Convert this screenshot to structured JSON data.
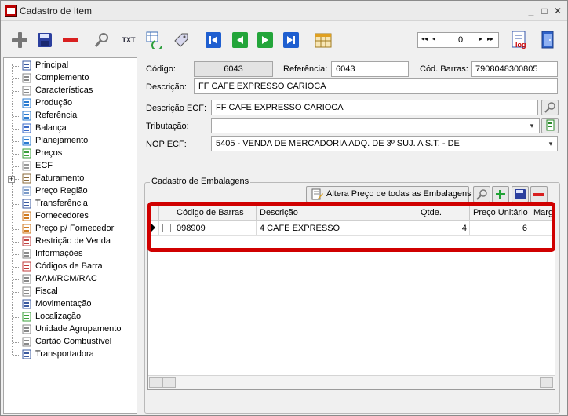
{
  "window": {
    "title": "Cadastro de Item"
  },
  "titlebar_buttons": [
    "_",
    "□",
    "✕"
  ],
  "toolbar": {
    "txt_label": "TXT",
    "counter": {
      "value": "0",
      "first": "◂◂",
      "prev": "◂",
      "next": "▸",
      "last": "▸▸"
    },
    "log_label": "log"
  },
  "sidebar": {
    "items": [
      {
        "label": "Principal"
      },
      {
        "label": "Complemento"
      },
      {
        "label": "Características"
      },
      {
        "label": "Produção"
      },
      {
        "label": "Referência"
      },
      {
        "label": "Balança"
      },
      {
        "label": "Planejamento"
      },
      {
        "label": "Preços"
      },
      {
        "label": "ECF"
      },
      {
        "label": "Faturamento"
      },
      {
        "label": "Preço Região"
      },
      {
        "label": "Transferência"
      },
      {
        "label": "Fornecedores"
      },
      {
        "label": "Preço p/ Fornecedor"
      },
      {
        "label": "Restrição de Venda"
      },
      {
        "label": "Informações"
      },
      {
        "label": "Códigos de Barra"
      },
      {
        "label": "RAM/RCM/RAC"
      },
      {
        "label": "Fiscal"
      },
      {
        "label": "Movimentação"
      },
      {
        "label": "Localização"
      },
      {
        "label": "Unidade Agrupamento"
      },
      {
        "label": "Cartão Combustível"
      },
      {
        "label": "Transportadora"
      }
    ]
  },
  "form": {
    "codigo_label": "Código:",
    "codigo_value": "6043",
    "referencia_label": "Referência:",
    "referencia_value": "6043",
    "cod_barras_label": "Cód. Barras:",
    "cod_barras_value": "7908048300805",
    "descricao_label": "Descrição:",
    "descricao_value": "FF CAFE EXPRESSO CARIOCA",
    "descricao_ecf_label": "Descrição ECF:",
    "descricao_ecf_value": "FF CAFE EXPRESSO CARIOCA",
    "tributacao_label": "Tributação:",
    "tributacao_value": "",
    "nop_ecf_label": "NOP ECF:",
    "nop_ecf_value": "5405 - VENDA DE MERCADORIA ADQ. DE 3º SUJ. A S.T. - DE"
  },
  "embalagens": {
    "group_title": "Cadastro de Embalagens",
    "altera_button": "Altera Preço de todas as Embalagens",
    "columns": [
      "Código de Barras",
      "Descrição",
      "Qtde.",
      "Preço Unitário",
      "Marge"
    ],
    "rows": [
      {
        "codigo": "098909",
        "descricao": "4 CAFE EXPRESSO",
        "qtde": "4",
        "preco": "6",
        "margem": ""
      }
    ]
  }
}
